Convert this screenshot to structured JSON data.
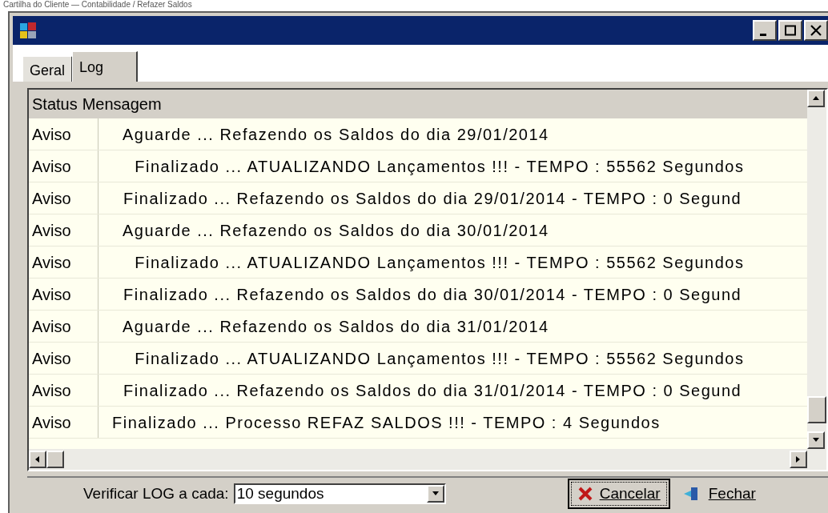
{
  "caption": "Cartilha do Cliente — Contabilidade / Refazer Saldos",
  "tabs": [
    {
      "label": "Geral",
      "selected": false
    },
    {
      "label": "Log",
      "selected": true
    }
  ],
  "log": {
    "columns": [
      "Status",
      "Mensagem"
    ],
    "rows": [
      {
        "status": "Aviso",
        "message": "  Aguarde ... Refazendo os Saldos do dia 29/01/2014"
      },
      {
        "status": "Aviso",
        "message": "    Finalizado ... ATUALIZANDO Lançamentos !!! - TEMPO : 55562 Segundos"
      },
      {
        "status": "Aviso",
        "message": "  Finalizado ... Refazendo os Saldos do dia 29/01/2014 - TEMPO : 0 Segund"
      },
      {
        "status": "Aviso",
        "message": "  Aguarde ... Refazendo os Saldos do dia 30/01/2014"
      },
      {
        "status": "Aviso",
        "message": "    Finalizado ... ATUALIZANDO Lançamentos !!! - TEMPO : 55562 Segundos"
      },
      {
        "status": "Aviso",
        "message": "  Finalizado ... Refazendo os Saldos do dia 30/01/2014 - TEMPO : 0 Segund"
      },
      {
        "status": "Aviso",
        "message": "  Aguarde ... Refazendo os Saldos do dia 31/01/2014"
      },
      {
        "status": "Aviso",
        "message": "    Finalizado ... ATUALIZANDO Lançamentos !!! - TEMPO : 55562 Segundos"
      },
      {
        "status": "Aviso",
        "message": "  Finalizado ... Refazendo os Saldos do dia 31/01/2014 - TEMPO : 0 Segund"
      },
      {
        "status": "Aviso",
        "message": "Finalizado ... Processo REFAZ SALDOS !!! - TEMPO : 4 Segundos"
      }
    ]
  },
  "footer": {
    "interval_label": "Verificar LOG a cada:",
    "interval_value": "10 segundos",
    "buttons": [
      {
        "kind": "cancel",
        "label": "Cancelar"
      },
      {
        "kind": "close",
        "label": "Fechar"
      }
    ]
  }
}
